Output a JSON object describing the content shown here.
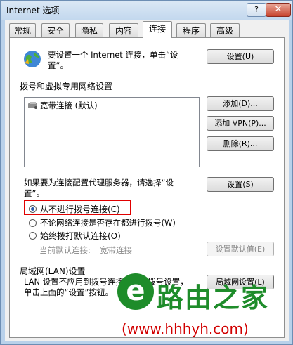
{
  "window": {
    "title": "Internet 选项",
    "help_label": "?",
    "close_label": "✕"
  },
  "tabs": [
    {
      "label": "常规"
    },
    {
      "label": "安全"
    },
    {
      "label": "隐私"
    },
    {
      "label": "内容"
    },
    {
      "label": "连接"
    },
    {
      "label": "程序"
    },
    {
      "label": "高级"
    }
  ],
  "active_tab": "连接",
  "setup": {
    "text": "要设置一个 Internet 连接，单击“设置”。",
    "button": "设置(U)"
  },
  "dialup": {
    "header": "拨号和虚拟专用网络设置",
    "items": [
      "宽带连接 (默认)"
    ],
    "add_button": "添加(D)...",
    "add_vpn_button": "添加 VPN(P)...",
    "delete_button": "删除(R)...",
    "proxy_text": "如果要为连接配置代理服务器，请选择“设置”。",
    "settings_button": "设置(S)",
    "options": [
      {
        "label": "从不进行拨号连接(C)",
        "selected": true
      },
      {
        "label": "不论网络连接是否存在都进行拨号(W)",
        "selected": false
      },
      {
        "label": "始终拨打默认连接(O)",
        "selected": false
      }
    ],
    "current_default_label": "当前默认连接:",
    "current_default_value": "宽带连接",
    "set_default_button": "设置默认值(E)"
  },
  "lan": {
    "header": "局域网(LAN)设置",
    "text": "LAN 设置不应用到拨号连接。对于拨号设置，单击上面的“设置”按钮。",
    "button": "局域网设置(L)"
  },
  "watermark": {
    "logo_text": "路由之家",
    "url": "(www.hhhyh.com)"
  },
  "colors": {
    "highlight": "#e00000",
    "watermark_green": "#1e8c2a"
  }
}
